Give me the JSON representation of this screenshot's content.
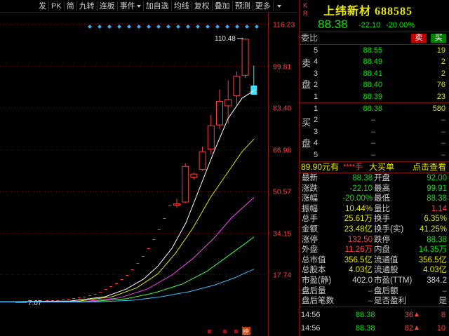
{
  "toolbar": {
    "items": [
      "发",
      "PK",
      "简",
      "九转",
      "连板",
      "事件",
      "加自选",
      "均线",
      "复权",
      "叠加",
      "预测",
      "更多"
    ]
  },
  "chart": {
    "price_axis": [
      "116.23",
      "99.81",
      "83.40",
      "66.98",
      "50.57",
      "34.15",
      "17.74"
    ],
    "high_label": "110.48",
    "low_label": "7.07",
    "flag_label": "榜"
  },
  "chart_data": {
    "type": "candlestick",
    "ylim": [
      1,
      116.23
    ],
    "last_candle": {
      "open": 92.0,
      "high": 99.91,
      "low": 88.38,
      "close": 88.38
    },
    "prior_peak_high": 110.48,
    "base_low": 7.07
  },
  "quote": {
    "kr": "K\nR",
    "name": "上纬新材",
    "code": "688585",
    "price": "88.38",
    "change": "-22.10",
    "change_pct": "-20.00%"
  },
  "weibi": {
    "label": "委比",
    "sell": "卖",
    "buy": "买"
  },
  "asks": [
    {
      "level": "5",
      "price": "88.55",
      "volume": "19"
    },
    {
      "level": "4",
      "price": "88.49",
      "volume": "2"
    },
    {
      "level": "3",
      "price": "88.41",
      "volume": "2"
    },
    {
      "level": "2",
      "price": "88.40",
      "volume": "76"
    },
    {
      "level": "1",
      "price": "88.39",
      "volume": "23"
    }
  ],
  "bids": [
    {
      "level": "1",
      "price": "88.38",
      "volume": "580"
    },
    {
      "level": "2",
      "price": "",
      "volume": ""
    },
    {
      "level": "3",
      "price": "",
      "volume": ""
    },
    {
      "level": "4",
      "price": "",
      "volume": ""
    },
    {
      "level": "5",
      "price": "",
      "volume": ""
    }
  ],
  "book_side": {
    "sell_top": "卖",
    "sell_bottom": "盘",
    "buy_top": "买",
    "buy_bottom": "盘",
    "dash": "–"
  },
  "big_order": {
    "price": "89.90元有",
    "stars": "****手",
    "title": "大买单",
    "link": "点击查看"
  },
  "stats": [
    {
      "l1": "最新",
      "v1": "88.38",
      "c1": "#00e600",
      "l2": "开盘",
      "v2": "92.00",
      "c2": "#00e600"
    },
    {
      "l1": "涨跌",
      "v1": "-22.10",
      "c1": "#00e600",
      "l2": "最高",
      "v2": "99.91",
      "c2": "#00e600"
    },
    {
      "l1": "涨幅",
      "v1": "-20.00%",
      "c1": "#00e600",
      "l2": "最低",
      "v2": "88.38",
      "c2": "#00e600"
    },
    {
      "l1": "振幅",
      "v1": "10.44%",
      "c1": "#e6e600",
      "l2": "量比",
      "v2": "1.14",
      "c2": "#ff4040"
    },
    {
      "l1": "总手",
      "v1": "25.61万",
      "c1": "#e6e600",
      "l2": "换手",
      "v2": "6.35%",
      "c2": "#e6e600"
    },
    {
      "l1": "金额",
      "v1": "23.48亿",
      "c1": "#e6e600",
      "l2": "换手(实)",
      "v2": "41.25%",
      "c2": "#e6e600"
    },
    {
      "l1": "涨停",
      "v1": "132.50",
      "c1": "#ff4040",
      "l2": "跌停",
      "v2": "88.38",
      "c2": "#00e600"
    },
    {
      "l1": "外盘",
      "v1": "11.26万",
      "c1": "#ff4040",
      "l2": "内盘",
      "v2": "14.35万",
      "c2": "#00e600"
    },
    {
      "l1": "总市值",
      "v1": "356.5亿",
      "c1": "#e6e600",
      "l2": "流通值",
      "v2": "356.5亿",
      "c2": "#e6e600"
    },
    {
      "l1": "总股本",
      "v1": "4.03亿",
      "c1": "#e6e600",
      "l2": "流通股",
      "v2": "4.03亿",
      "c2": "#e6e600"
    },
    {
      "l1": "市盈(静)",
      "v1": "402.0",
      "c1": "#d0d0d0",
      "l2": "市盈(TTM)",
      "v2": "384.2",
      "c2": "#d0d0d0"
    },
    {
      "l1": "盘后量",
      "v1": "–",
      "c1": "#909090",
      "l2": "盘后额",
      "v2": "–",
      "c2": "#909090"
    },
    {
      "l1": "盘后笔数",
      "v1": "–",
      "c1": "#909090",
      "l2": "是否盈利",
      "v2": "是",
      "c2": "#d0d0d0"
    }
  ],
  "ticks": [
    {
      "time": "14:56",
      "price": "88.38",
      "volume": "36",
      "count": "8"
    },
    {
      "time": "14:56",
      "price": "88.38",
      "volume": "82",
      "count": "10"
    }
  ],
  "colors": {
    "up": "#ff4040",
    "down": "#00e600",
    "accent": "#e6e600",
    "border": "#7a1010"
  }
}
